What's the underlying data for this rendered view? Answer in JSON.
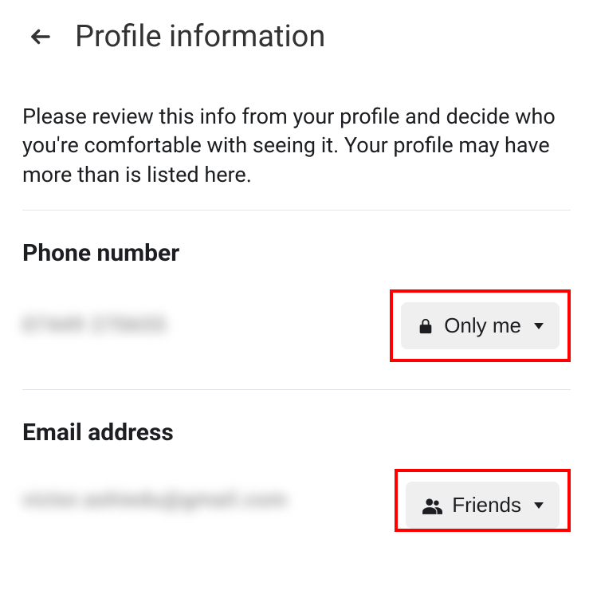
{
  "header": {
    "title": "Profile information"
  },
  "description": "Please review this info from your profile and decide who you're comfortable with seeing it. Your profile may have more than is listed here.",
  "sections": {
    "phone": {
      "title": "Phone number",
      "value": "07449 270655",
      "audience": "Only me",
      "audience_icon": "lock-icon"
    },
    "email": {
      "title": "Email address",
      "value": "victor.ashiedu@gmail.com",
      "audience": "Friends",
      "audience_icon": "friends-icon"
    }
  }
}
